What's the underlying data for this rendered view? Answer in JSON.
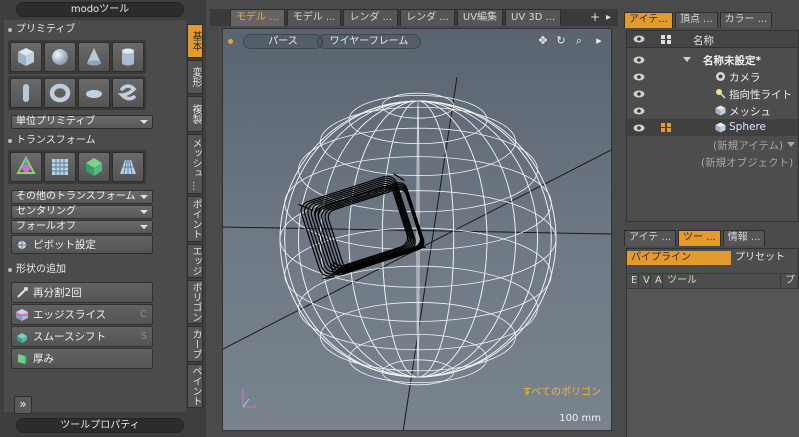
{
  "left": {
    "title": "modoツール",
    "sections": {
      "primitive": "プリミティブ",
      "transform": "トランスフォーム",
      "shape_add": "形状の追加"
    },
    "primitive_dropdown": "単位プリミティブ",
    "transform_dropdowns": [
      "その他のトランスフォーム",
      "センタリング",
      "フォールオフ"
    ],
    "pivot_button": "ピボット設定",
    "shape_buttons": [
      {
        "label": "再分割2回",
        "key": ""
      },
      {
        "label": "エッジスライス",
        "key": "C"
      },
      {
        "label": "スムースシフト",
        "key": "S"
      },
      {
        "label": "厚み",
        "key": ""
      }
    ],
    "more": "»",
    "tool_properties": "ツールプロパティ",
    "vertical_tabs": [
      "基本",
      "変形",
      "複製",
      "メッシュ ...",
      "ポイント",
      "エッジ",
      "ポリゴン",
      "カーブ",
      "ペイント"
    ]
  },
  "viewport": {
    "tabs": [
      "モデル ...",
      "モデル ...",
      "レンダ ...",
      "レンダ ...",
      "UV編集",
      "UV 3D ..."
    ],
    "plus": "+",
    "more": "▸",
    "mode_chips": [
      "パース",
      "ワイヤーフレーム"
    ],
    "overlay_label": "すべてのポリゴン",
    "scale_label": "100 mm",
    "accent": "#f3a63a"
  },
  "items_panel": {
    "tabs": [
      "アイテ...",
      "頂点 ...",
      "カラー ..."
    ],
    "header_name": "名称",
    "rows": [
      {
        "label": "名称未設定*",
        "bold": true
      },
      {
        "label": "カメラ"
      },
      {
        "label": "指向性ライト"
      },
      {
        "label": "メッシュ"
      },
      {
        "label": "Sphere"
      },
      {
        "label": "(新規アイテム)"
      },
      {
        "label": "(新規オブジェクト)"
      }
    ]
  },
  "tool_panel": {
    "tabs": [
      "アイテ ...",
      "ツー ...",
      "情報 ..."
    ],
    "subtabs": [
      "パイプライン",
      "プリセット"
    ],
    "columns": [
      "E",
      "V",
      "A",
      "ツール",
      "プ"
    ]
  }
}
